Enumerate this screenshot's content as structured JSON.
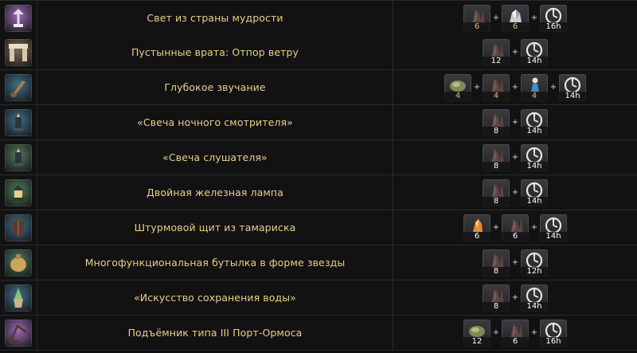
{
  "colors": {
    "item_name": "#e8cf8a",
    "quantity_gold": "#e2c060",
    "quantity_white": "#ffffff",
    "row_border": "#2a2a2c"
  },
  "plus_symbol": "+",
  "rows": [
    {
      "icon": "lamp-icon",
      "icon_bg": "#9e6ab8",
      "name": "Свет из страны мудрости",
      "materials": [
        {
          "icon": "ore-icon",
          "qty": "6",
          "qty_color": "gold"
        },
        {
          "icon": "crystal-icon",
          "qty": "6",
          "qty_color": "gold"
        },
        {
          "icon": "timer-icon",
          "qty": "16h",
          "qty_color": "white"
        }
      ]
    },
    {
      "icon": "arch-gate-icon",
      "icon_bg": "#7a6a55",
      "name": "Пустынные врата: Отпор ветру",
      "materials": [
        {
          "icon": "ore-icon",
          "qty": "12",
          "qty_color": "white"
        },
        {
          "icon": "timer-icon",
          "qty": "14h",
          "qty_color": "white"
        }
      ]
    },
    {
      "icon": "horn-icon",
      "icon_bg": "#3d6f8c",
      "name": "Глубокое звучание",
      "materials": [
        {
          "icon": "shell-icon",
          "qty": "4",
          "qty_color": "gold"
        },
        {
          "icon": "ore-icon",
          "qty": "4",
          "qty_color": "gold"
        },
        {
          "icon": "figure-icon",
          "qty": "4",
          "qty_color": "gold"
        },
        {
          "icon": "timer-icon",
          "qty": "14h",
          "qty_color": "white"
        }
      ]
    },
    {
      "icon": "candle-icon",
      "icon_bg": "#3d6f8c",
      "name": "«Свеча ночного смотрителя»",
      "materials": [
        {
          "icon": "ore-icon",
          "qty": "8",
          "qty_color": "white"
        },
        {
          "icon": "timer-icon",
          "qty": "14h",
          "qty_color": "white"
        }
      ]
    },
    {
      "icon": "candle-icon",
      "icon_bg": "#4d7a5c",
      "name": "«Свеча слушателя»",
      "materials": [
        {
          "icon": "ore-icon",
          "qty": "8",
          "qty_color": "white"
        },
        {
          "icon": "timer-icon",
          "qty": "14h",
          "qty_color": "white"
        }
      ]
    },
    {
      "icon": "iron-lamp-icon",
      "icon_bg": "#4d7a5c",
      "name": "Двойная железная лампа",
      "materials": [
        {
          "icon": "ore-icon",
          "qty": "8",
          "qty_color": "white"
        },
        {
          "icon": "timer-icon",
          "qty": "14h",
          "qty_color": "white"
        }
      ]
    },
    {
      "icon": "shield-icon",
      "icon_bg": "#3d6f8c",
      "name": "Штурмовой щит из тамариска",
      "materials": [
        {
          "icon": "fire-crystal-icon",
          "qty": "6",
          "qty_color": "white"
        },
        {
          "icon": "ore-icon",
          "qty": "6",
          "qty_color": "white"
        },
        {
          "icon": "timer-icon",
          "qty": "14h",
          "qty_color": "white"
        }
      ]
    },
    {
      "icon": "bottle-icon",
      "icon_bg": "#4d7a5c",
      "name": "Многофункциональная бутылка в форме звезды",
      "materials": [
        {
          "icon": "ore-icon",
          "qty": "8",
          "qty_color": "white"
        },
        {
          "icon": "timer-icon",
          "qty": "12h",
          "qty_color": "white"
        }
      ]
    },
    {
      "icon": "vase-icon",
      "icon_bg": "#3d6f8c",
      "name": "«Искусство сохранения воды»",
      "materials": [
        {
          "icon": "ore-icon",
          "qty": "8",
          "qty_color": "white"
        },
        {
          "icon": "timer-icon",
          "qty": "14h",
          "qty_color": "white"
        }
      ]
    },
    {
      "icon": "crane-icon",
      "icon_bg": "#9e6ab8",
      "name": "Подъёмник типа III Порт-Ормоса",
      "materials": [
        {
          "icon": "shell-icon",
          "qty": "12",
          "qty_color": "white"
        },
        {
          "icon": "ore-icon",
          "qty": "6",
          "qty_color": "white"
        },
        {
          "icon": "timer-icon",
          "qty": "16h",
          "qty_color": "white"
        }
      ]
    }
  ]
}
